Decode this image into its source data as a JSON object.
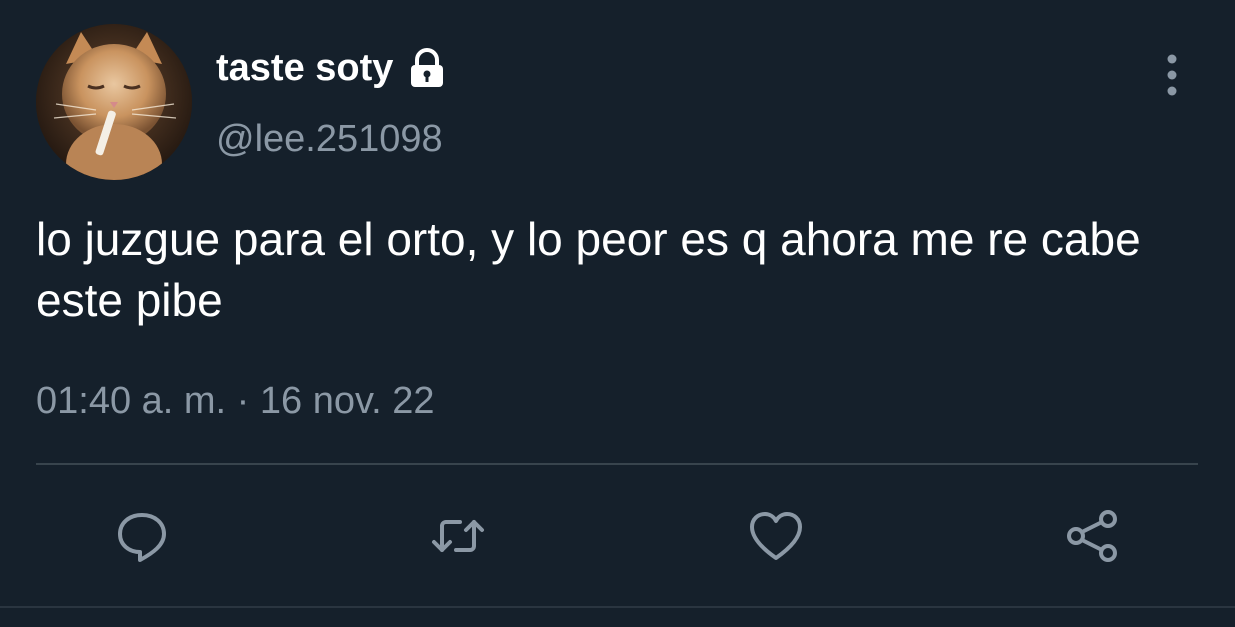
{
  "tweet": {
    "display_name": "taste soty",
    "handle": "@lee.251098",
    "text": "lo juzgue para el orto, y lo peor es q ahora me re cabe este pibe",
    "timestamp": "01:40 a. m. · 16 nov. 22",
    "protected_icon": "lock-icon",
    "avatar_icon": "cat-avatar"
  },
  "actions": [
    {
      "name": "reply",
      "icon": "reply-icon"
    },
    {
      "name": "retweet",
      "icon": "retweet-icon"
    },
    {
      "name": "like",
      "icon": "heart-icon"
    },
    {
      "name": "share",
      "icon": "share-icon"
    }
  ],
  "colors": {
    "background": "#15202b",
    "text_primary": "#ffffff",
    "text_secondary": "#8b98a5",
    "divider": "#38444d"
  }
}
